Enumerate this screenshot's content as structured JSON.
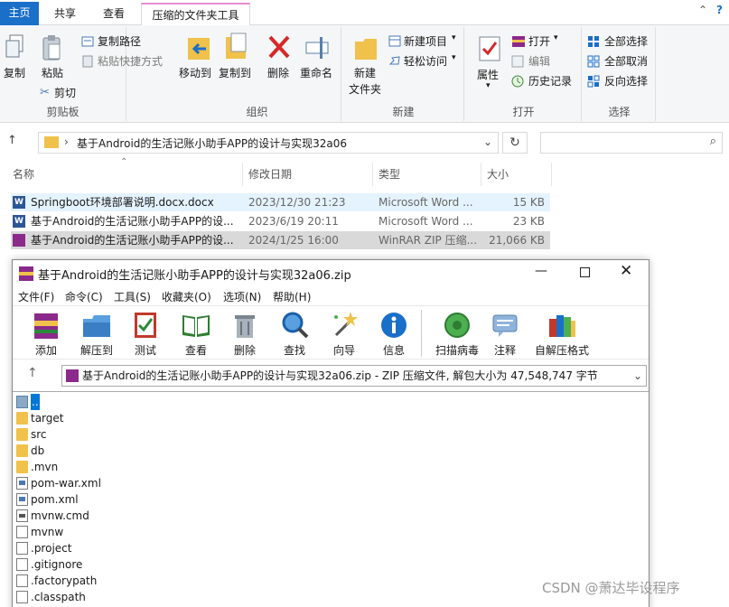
{
  "explorer": {
    "tabs": [
      "主页",
      "共享",
      "查看",
      "压缩的文件夹工具"
    ],
    "ribbon": {
      "clipboard": {
        "label": "剪贴板",
        "copy": "复制",
        "paste": "粘贴",
        "copy_path": "复制路径",
        "paste_shortcut": "粘贴快捷方式",
        "cut": "剪切"
      },
      "organize": {
        "label": "组织",
        "move_to": "移动到",
        "copy_to": "复制到",
        "delete": "删除",
        "rename": "重命名"
      },
      "new": {
        "label": "新建",
        "new_folder": "新建\n文件夹",
        "new_folder_l1": "新建",
        "new_folder_l2": "文件夹",
        "new_item": "新建项目",
        "easy_access": "轻松访问"
      },
      "open": {
        "label": "打开",
        "properties": "属性",
        "open": "打开",
        "edit": "编辑",
        "history": "历史记录"
      },
      "select": {
        "label": "选择",
        "select_all": "全部选择",
        "select_none": "全部取消",
        "invert": "反向选择"
      }
    },
    "address": "基于Android的生活记账小助手APP的设计与实现32a06",
    "columns": [
      "名称",
      "修改日期",
      "类型",
      "大小"
    ],
    "files": [
      {
        "name": "Springboot环境部署说明.docx.docx",
        "date": "2023/12/30 21:23",
        "type": "Microsoft Word ...",
        "size": "15 KB",
        "icon": "word-icon"
      },
      {
        "name": "基于Android的生活记账小助手APP的设...",
        "date": "2023/6/19 20:11",
        "type": "Microsoft Word ...",
        "size": "23 KB",
        "icon": "word-icon"
      },
      {
        "name": "基于Android的生活记账小助手APP的设...",
        "date": "2024/1/25 16:00",
        "type": "WinRAR ZIP 压缩...",
        "size": "21,066 KB",
        "icon": "winrar-icon"
      }
    ]
  },
  "winrar": {
    "title": "基于Android的生活记账小助手APP的设计与实现32a06.zip",
    "menu": [
      "文件(F)",
      "命令(C)",
      "工具(S)",
      "收藏夹(O)",
      "选项(N)",
      "帮助(H)"
    ],
    "toolbar": [
      "添加",
      "解压到",
      "测试",
      "查看",
      "删除",
      "查找",
      "向导",
      "信息",
      "扫描病毒",
      "注释",
      "自解压格式"
    ],
    "path": "基于Android的生活记账小助手APP的设计与实现32a06.zip - ZIP 压缩文件, 解包大小为 47,548,747 字节",
    "items": [
      {
        "name": "..",
        "icon": "parent-folder-icon"
      },
      {
        "name": "target",
        "icon": "folder-icon"
      },
      {
        "name": "src",
        "icon": "folder-icon"
      },
      {
        "name": "db",
        "icon": "folder-icon"
      },
      {
        "name": ".mvn",
        "icon": "folder-icon"
      },
      {
        "name": "pom-war.xml",
        "icon": "xml-icon"
      },
      {
        "name": "pom.xml",
        "icon": "xml-icon"
      },
      {
        "name": "mvnw.cmd",
        "icon": "cmd-icon"
      },
      {
        "name": "mvnw",
        "icon": "file-icon"
      },
      {
        "name": ".project",
        "icon": "file-icon"
      },
      {
        "name": ".gitignore",
        "icon": "file-icon"
      },
      {
        "name": ".factorypath",
        "icon": "file-icon"
      },
      {
        "name": ".classpath",
        "icon": "file-icon"
      }
    ]
  },
  "watermark": "CSDN @萧达毕设程序",
  "colors": {
    "accent": "#1a6fc9",
    "selected_row": "#cce8ff",
    "highlight_row": "#d9d9d9",
    "folder": "#f0c14b"
  }
}
